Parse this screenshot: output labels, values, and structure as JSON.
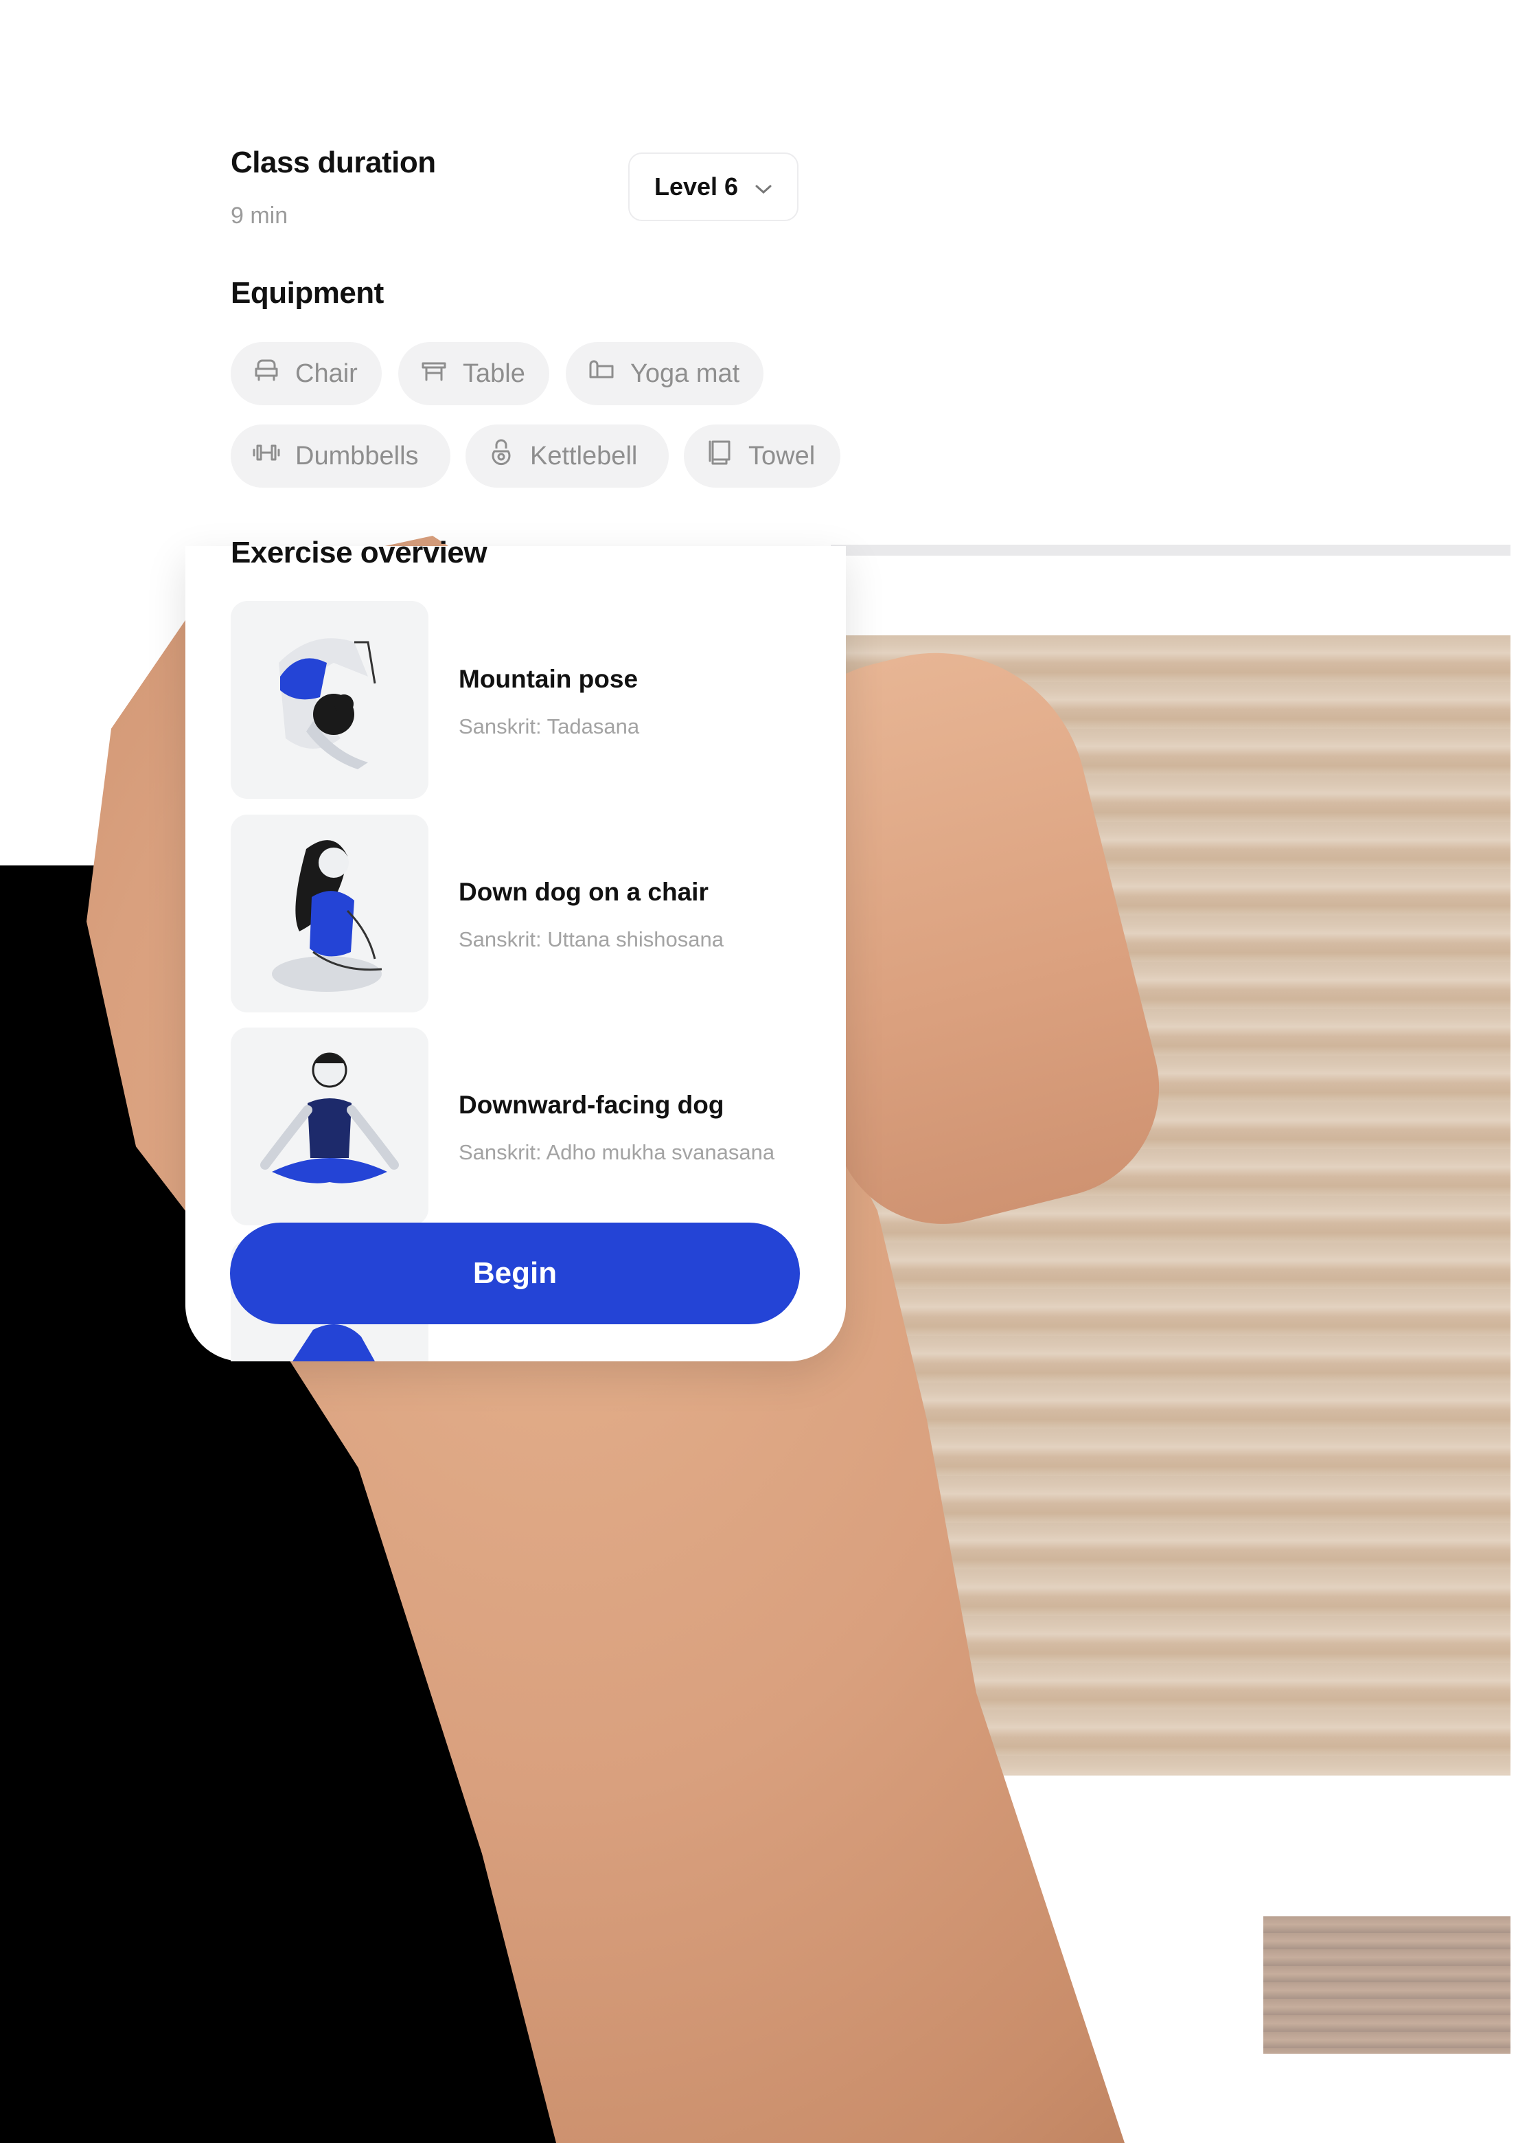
{
  "class_duration": {
    "title": "Class duration",
    "value": "9 min"
  },
  "level_dropdown": {
    "selected": "Level 6"
  },
  "equipment": {
    "title": "Equipment",
    "items": [
      {
        "label": "Chair",
        "icon": "chair-icon"
      },
      {
        "label": "Table",
        "icon": "table-icon"
      },
      {
        "label": "Yoga mat",
        "icon": "yoga-mat-icon"
      },
      {
        "label": "Dumbbells",
        "icon": "dumbbell-icon"
      },
      {
        "label": "Kettlebell",
        "icon": "kettlebell-icon"
      },
      {
        "label": "Towel",
        "icon": "towel-icon"
      }
    ]
  },
  "exercise_overview": {
    "title": "Exercise overview",
    "items": [
      {
        "name": "Mountain pose",
        "sanskrit": "Sanskrit: Tadasana"
      },
      {
        "name": "Down dog on a chair",
        "sanskrit": "Sanskrit: Uttana shishosana"
      },
      {
        "name": "Downward-facing dog",
        "sanskrit": "Sanskrit: Adho mukha svanasana"
      }
    ]
  },
  "actions": {
    "begin_label": "Begin"
  },
  "colors": {
    "accent": "#2444d6",
    "chip_bg": "#f2f2f3",
    "muted_text": "#9b9b9b"
  }
}
